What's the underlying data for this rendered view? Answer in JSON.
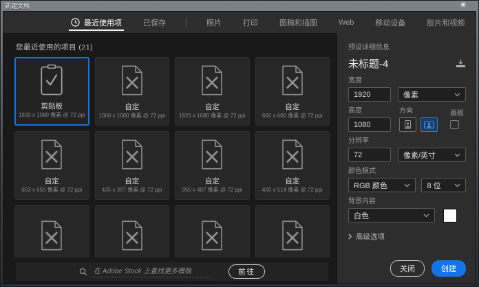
{
  "window": {
    "title": "新建文档",
    "close_glyph": "✕"
  },
  "tabs": [
    {
      "label": "最近使用项",
      "active": true,
      "icon": "clock"
    },
    {
      "label": "已保存"
    },
    {
      "label": "照片"
    },
    {
      "label": "打印"
    },
    {
      "label": "图稿和插图"
    },
    {
      "label": "Web"
    },
    {
      "label": "移动设备"
    },
    {
      "label": "胶片和视频"
    }
  ],
  "recent": {
    "header": "您最近使用的项目 (21)",
    "tiles": [
      {
        "icon": "clipboard-check",
        "name": "剪贴板",
        "spec": "1920 x 1080 像素 @ 72 ppi",
        "selected": true
      },
      {
        "icon": "doc-x",
        "name": "自定",
        "spec": "1000 x 1000 像素 @ 72 ppi"
      },
      {
        "icon": "doc-x",
        "name": "自定",
        "spec": "1920 x 1080 像素 @ 72 ppi"
      },
      {
        "icon": "doc-x",
        "name": "自定",
        "spec": "600 x 600 像素 @ 72 ppi"
      },
      {
        "icon": "doc-x",
        "name": "自定",
        "spec": "653 x 650 像素 @ 72 ppi"
      },
      {
        "icon": "doc-x",
        "name": "自定",
        "spec": "435 x 397 像素 @ 72 ppi"
      },
      {
        "icon": "doc-x",
        "name": "自定",
        "spec": "350 x 407 像素 @ 72 ppi"
      },
      {
        "icon": "doc-x",
        "name": "自定",
        "spec": "400 x 514 像素 @ 72 ppi"
      },
      {
        "icon": "doc-x",
        "name": "",
        "spec": ""
      },
      {
        "icon": "doc-x",
        "name": "",
        "spec": ""
      },
      {
        "icon": "doc-x",
        "name": "",
        "spec": ""
      },
      {
        "icon": "doc-x",
        "name": "",
        "spec": ""
      }
    ]
  },
  "stock_search": {
    "placeholder": "在 Adobe Stock 上查找更多模板",
    "go_label": "前往"
  },
  "preset": {
    "header": "预设详细信息",
    "title": "未标题-4",
    "width_label": "宽度",
    "width_value": "1920",
    "width_unit": "像素",
    "height_label": "高度",
    "height_value": "1080",
    "orientation_label": "方向",
    "artboard_label": "画板",
    "resolution_label": "分辨率",
    "resolution_value": "72",
    "resolution_unit": "像素/英寸",
    "color_mode_label": "颜色模式",
    "color_mode": "RGB 颜色",
    "bit_depth": "8 位",
    "background_label": "背景内容",
    "background": "白色",
    "background_swatch": "#ffffff",
    "advanced_label": "高级选项",
    "close_label": "关闭",
    "create_label": "创建",
    "accent_color": "#1473e6"
  }
}
